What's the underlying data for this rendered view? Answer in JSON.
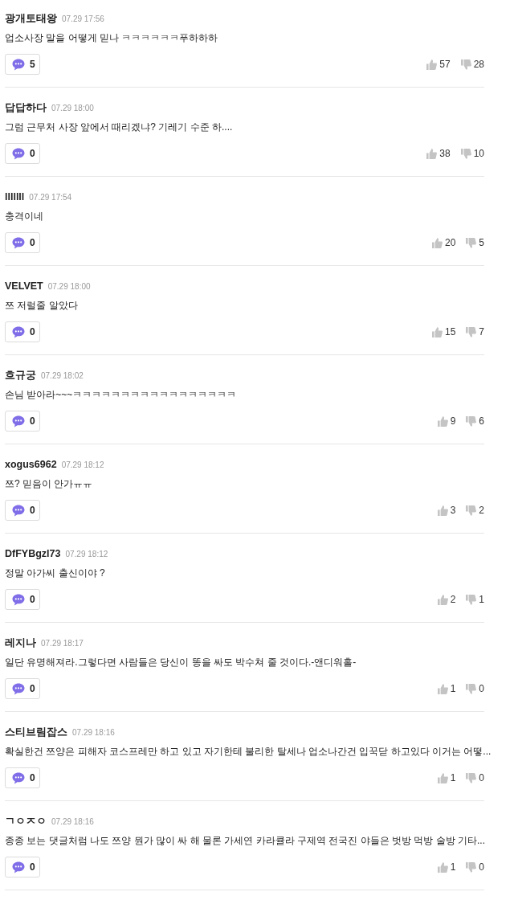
{
  "comments": [
    {
      "author": "광개토태왕",
      "time": "07.29 17:56",
      "text": "업소사장 말을 어떻게 믿나 ㅋㅋㅋㅋㅋㅋ푸하하하",
      "replies": "5",
      "likes": "57",
      "dislikes": "28"
    },
    {
      "author": "답답하다",
      "time": "07.29 18:00",
      "text": "그럼 근무처 사장 앞에서 때리겠냐? 기레기 수준 하....",
      "replies": "0",
      "likes": "38",
      "dislikes": "10"
    },
    {
      "author": "lllllll",
      "time": "07.29 17:54",
      "text": "충격이네",
      "replies": "0",
      "likes": "20",
      "dislikes": "5"
    },
    {
      "author": "VELVET",
      "time": "07.29 18:00",
      "text": "쯔 저럴줄 알았다",
      "replies": "0",
      "likes": "15",
      "dislikes": "7"
    },
    {
      "author": "흐규궁",
      "time": "07.29 18:02",
      "text": "손님 받아라~~~ㅋㅋㅋㅋㅋㅋㅋㅋㅋㅋㅋㅋㅋㅋㅋㅋㅋ",
      "replies": "0",
      "likes": "9",
      "dislikes": "6"
    },
    {
      "author": "xogus6962",
      "time": "07.29 18:12",
      "text": "쯔? 믿음이 안가ㅠㅠ",
      "replies": "0",
      "likes": "3",
      "dislikes": "2"
    },
    {
      "author": "DfFYBgzl73",
      "time": "07.29 18:12",
      "text": "정말 아가씨 출신이야 ?",
      "replies": "0",
      "likes": "2",
      "dislikes": "1"
    },
    {
      "author": "레지나",
      "time": "07.29 18:17",
      "text": "일단 유명해져라.그렇다면 사람들은 당신이 똥을 싸도 박수쳐 줄 것이다.-앤디워홀-",
      "replies": "0",
      "likes": "1",
      "dislikes": "0"
    },
    {
      "author": "스티브림잡스",
      "time": "07.29 18:16",
      "text": "확실한건 쯔양은 피해자 코스프레만 하고 있고 자기한테 불리한 탈세나 업소나간건 입꾹닫 하고있다 이거는 어떻...",
      "replies": "0",
      "likes": "1",
      "dislikes": "0"
    },
    {
      "author": "ㄱㅇㅈㅇ",
      "time": "07.29 18:16",
      "text": "종종 보는 댓글처럼 나도 쯔양 뭔가 많이 싸 해 물론 가세연 카라큘라 구제역 전국진 야들은 벗방 먹방 술방 기타...",
      "replies": "0",
      "likes": "1",
      "dislikes": "0"
    }
  ]
}
